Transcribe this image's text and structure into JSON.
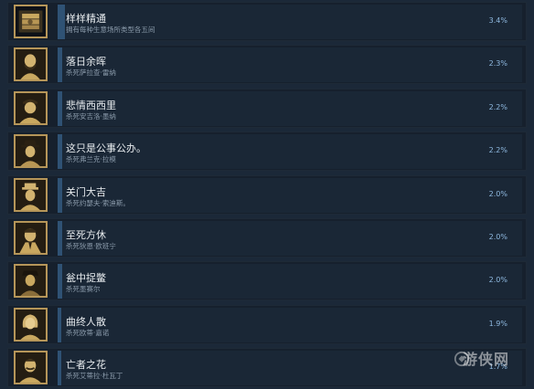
{
  "achievements": [
    {
      "title": "样样精通",
      "desc": "拥有每种生意场所类型各五间",
      "percent": "3.4%",
      "percent_value": 3.4,
      "icon": "money-stack-icon"
    },
    {
      "title": "落日余晖",
      "desc": "杀死萨拉查·雷纳",
      "percent": "2.3%",
      "percent_value": 2.3,
      "icon": "bearded-man-portrait-icon"
    },
    {
      "title": "悲情西西里",
      "desc": "杀死安吉洛·墨纳",
      "percent": "2.2%",
      "percent_value": 2.2,
      "icon": "man-in-cap-portrait-icon"
    },
    {
      "title": "这只是公事公办。",
      "desc": "杀死弗兰克·拉模",
      "percent": "2.2%",
      "percent_value": 2.2,
      "icon": "man-in-fedora-portrait-icon"
    },
    {
      "title": "关门大吉",
      "desc": "杀死约瑟夫·索迪斯。",
      "percent": "2.0%",
      "percent_value": 2.0,
      "icon": "man-in-hat-portrait-icon"
    },
    {
      "title": "至死方休",
      "desc": "杀死狄恩·欧班宁",
      "percent": "2.0%",
      "percent_value": 2.0,
      "icon": "man-in-suit-portrait-icon"
    },
    {
      "title": "瓮中捉鳖",
      "desc": "杀死墨赛尔",
      "percent": "2.0%",
      "percent_value": 2.0,
      "icon": "man-in-dark-hat-portrait-icon"
    },
    {
      "title": "曲终人散",
      "desc": "杀死欧蒂·嘉诺",
      "percent": "1.9%",
      "percent_value": 1.9,
      "icon": "woman-portrait-icon"
    },
    {
      "title": "亡者之花",
      "desc": "杀死艾蒂拉·杜瓦丁",
      "percent": "1.7%",
      "percent_value": 1.7,
      "icon": "man-with-mustache-portrait-icon"
    }
  ],
  "watermark": "游侠网"
}
